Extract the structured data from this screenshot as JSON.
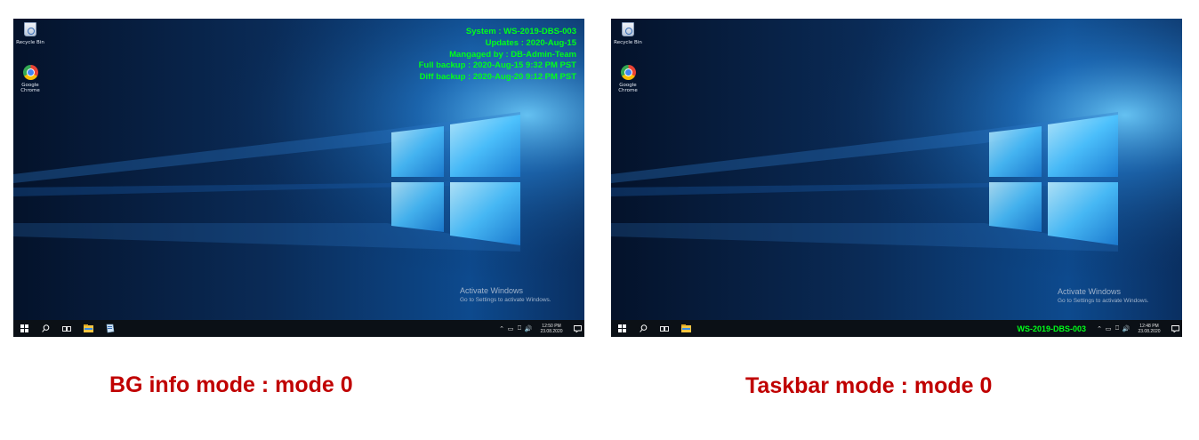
{
  "screens": {
    "left": {
      "desktop_icons": [
        {
          "label": "Recycle Bin",
          "icon": "recycle-bin-icon"
        },
        {
          "label": "Google Chrome",
          "icon": "chrome-icon"
        }
      ],
      "bginfo_lines": [
        "System : WS-2019-DBS-003",
        "Updates : 2020-Aug-15",
        "Mangaged by : DB-Admin-Team",
        "Full backup : 2020-Aug-15 9:32 PM PST",
        "Diff backup : 2020-Aug-20 9:12 PM PST"
      ],
      "activate": {
        "title": "Activate Windows",
        "subtitle": "Go to Settings to activate Windows."
      },
      "taskbar": {
        "pinned": [
          "start-icon",
          "search-icon",
          "task-view-icon",
          "file-explorer-icon",
          "server-manager-icon"
        ],
        "clock_time": "12:50 PM",
        "clock_date": "23.08.2020"
      }
    },
    "right": {
      "desktop_icons": [
        {
          "label": "Recycle Bin",
          "icon": "recycle-bin-icon"
        },
        {
          "label": "Google Chrome",
          "icon": "chrome-icon"
        }
      ],
      "activate": {
        "title": "Activate Windows",
        "subtitle": "Go to Settings to activate Windows."
      },
      "taskbar": {
        "pinned": [
          "start-icon",
          "search-icon",
          "task-view-icon",
          "file-explorer-icon"
        ],
        "system_name": "WS-2019-DBS-003",
        "clock_time": "12:48 PM",
        "clock_date": "23.08.2020"
      }
    }
  },
  "captions": {
    "left": "BG info mode : mode 0",
    "right": "Taskbar mode : mode 0"
  },
  "colors": {
    "bginfo_text": "#00ff1a",
    "caption_text": "#c00000",
    "taskbar_bg": "#0b1016"
  }
}
